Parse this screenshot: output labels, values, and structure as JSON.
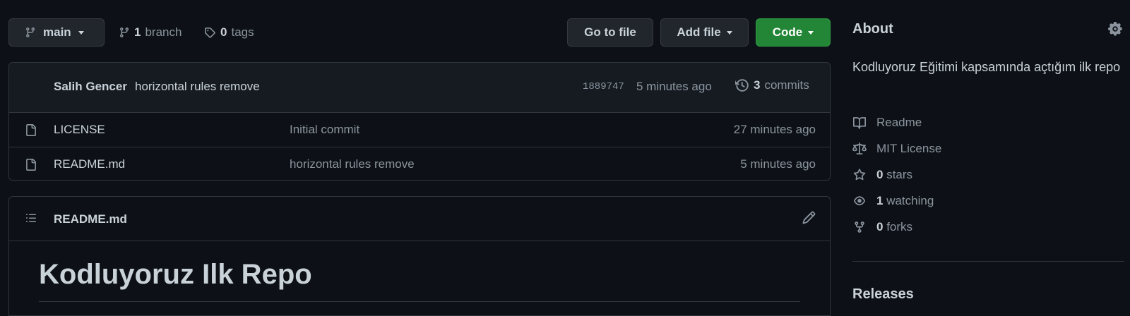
{
  "toolbar": {
    "branch_name": "main",
    "branch_count": "1",
    "branch_label": "branch",
    "tag_count": "0",
    "tag_label": "tags",
    "go_to_file": "Go to file",
    "add_file": "Add file",
    "code": "Code"
  },
  "latest_commit": {
    "author": "Salih Gencer",
    "message": "horizontal rules remove",
    "sha": "1889747",
    "time": "5 minutes ago",
    "commit_count": "3",
    "commit_label": "commits"
  },
  "files": [
    {
      "name": "LICENSE",
      "message": "Initial commit",
      "time": "27 minutes ago"
    },
    {
      "name": "README.md",
      "message": "horizontal rules remove",
      "time": "5 minutes ago"
    }
  ],
  "readme": {
    "filename": "README.md",
    "heading": "Kodluyoruz Ilk Repo"
  },
  "about": {
    "title": "About",
    "description": "Kodluyoruz Eğitimi kapsamında açtığım ilk repo",
    "readme": "Readme",
    "license": "MIT License",
    "stars_count": "0",
    "stars_label": "stars",
    "watching_count": "1",
    "watching_label": "watching",
    "forks_count": "0",
    "forks_label": "forks"
  },
  "releases": {
    "title": "Releases"
  },
  "colors": {
    "background": "#0d1117",
    "code_button": "#238636",
    "border": "#30363d",
    "muted_text": "#8b949e"
  },
  "icons": [
    "branch-icon",
    "tag-icon",
    "history-icon",
    "file-icon",
    "list-icon",
    "pencil-icon",
    "gear-icon",
    "book-icon",
    "scale-icon",
    "star-icon",
    "eye-icon",
    "fork-icon"
  ]
}
